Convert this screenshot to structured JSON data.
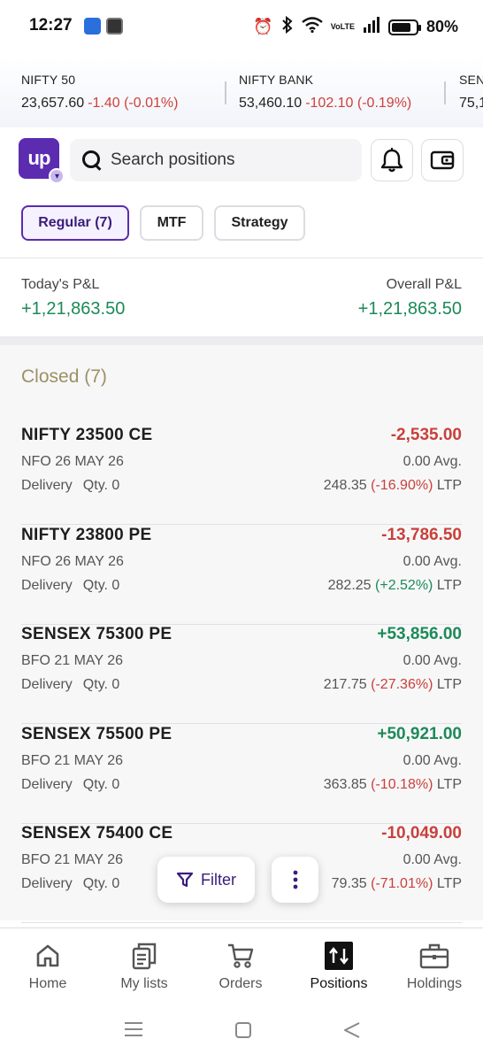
{
  "status_bar": {
    "time": "12:27",
    "battery": "80%",
    "battery_level": 0.8,
    "network": "VoLTE"
  },
  "ticker": [
    {
      "name": "NIFTY 50",
      "value": "23,657.60",
      "change": "-1.40 (-0.01%)"
    },
    {
      "name": "NIFTY BANK",
      "value": "53,460.10",
      "change": "-102.10 (-0.19%)"
    },
    {
      "name": "SENSEX",
      "value": "75,1",
      "change": ""
    }
  ],
  "header": {
    "logo_text": "up",
    "search_placeholder": "Search positions",
    "icons": [
      "bell-icon",
      "wallet-icon"
    ]
  },
  "tabs": [
    {
      "label": "Regular (7)",
      "active": true
    },
    {
      "label": "MTF",
      "active": false
    },
    {
      "label": "Strategy",
      "active": false
    }
  ],
  "pnl": {
    "today_label": "Today's P&L",
    "today_value": "+1,21,863.50",
    "overall_label": "Overall P&L",
    "overall_value": "+1,21,863.50"
  },
  "section_title": "Closed (7)",
  "positions": [
    {
      "name": "NIFTY 23500 CE",
      "pnl": "-2,535.00",
      "pnl_sign": "neg",
      "exchange": "NFO 26 MAY 26",
      "avg": "0.00 Avg.",
      "product": "Delivery",
      "qty": "Qty. 0",
      "ltp": "248.35",
      "ltp_change": "(-16.90%)",
      "ltp_sign": "neg",
      "ltp_label": "LTP"
    },
    {
      "name": "NIFTY 23800 PE",
      "pnl": "-13,786.50",
      "pnl_sign": "neg",
      "exchange": "NFO 26 MAY 26",
      "avg": "0.00 Avg.",
      "product": "Delivery",
      "qty": "Qty. 0",
      "ltp": "282.25",
      "ltp_change": "(+2.52%)",
      "ltp_sign": "pos",
      "ltp_label": "LTP"
    },
    {
      "name": "SENSEX 75300 PE",
      "pnl": "+53,856.00",
      "pnl_sign": "pos",
      "exchange": "BFO 21 MAY 26",
      "avg": "0.00 Avg.",
      "product": "Delivery",
      "qty": "Qty. 0",
      "ltp": "217.75",
      "ltp_change": "(-27.36%)",
      "ltp_sign": "neg",
      "ltp_label": "LTP"
    },
    {
      "name": "SENSEX 75500 PE",
      "pnl": "+50,921.00",
      "pnl_sign": "pos",
      "exchange": "BFO 21 MAY 26",
      "avg": "0.00 Avg.",
      "product": "Delivery",
      "qty": "Qty. 0",
      "ltp": "363.85",
      "ltp_change": "(-10.18%)",
      "ltp_sign": "neg",
      "ltp_label": "LTP"
    },
    {
      "name": "SENSEX 75400 CE",
      "pnl": "-10,049.00",
      "pnl_sign": "neg",
      "exchange": "BFO 21 MAY 26",
      "avg": "0.00 Avg.",
      "product": "Delivery",
      "qty": "Qty. 0",
      "ltp": "79.35",
      "ltp_change": "(-71.01%)",
      "ltp_sign": "neg",
      "ltp_label": "LTP"
    }
  ],
  "floating": {
    "filter_label": "Filter"
  },
  "bottom_nav": [
    {
      "label": "Home",
      "icon": "home-icon",
      "active": false
    },
    {
      "label": "My lists",
      "icon": "lists-icon",
      "active": false
    },
    {
      "label": "Orders",
      "icon": "cart-icon",
      "active": false
    },
    {
      "label": "Positions",
      "icon": "positions-icon",
      "active": true
    },
    {
      "label": "Holdings",
      "icon": "briefcase-icon",
      "active": false
    }
  ],
  "colors": {
    "brand": "#5b2bb0",
    "positive": "#1c8a58",
    "negative": "#c9403a",
    "section": "#9a9164"
  }
}
